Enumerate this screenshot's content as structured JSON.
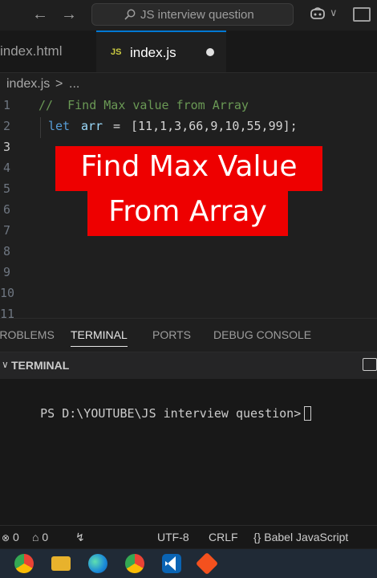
{
  "titlebar": {
    "search_text": "JS interview question",
    "back_arrow": "←",
    "forward_arrow": "→"
  },
  "tabs": [
    {
      "label": "index.html",
      "active": false
    },
    {
      "label": "index.js",
      "active": true,
      "icon": "JS",
      "modified": true
    }
  ],
  "breadcrumb": {
    "file": "index.js",
    "separator": ">",
    "rest": "..."
  },
  "editor": {
    "line_numbers": [
      "1",
      "2",
      "3",
      "4",
      "5",
      "6",
      "7",
      "8",
      "9",
      "10",
      "11"
    ],
    "current_line": "3",
    "code": {
      "line1_comment": "//  Find Max value from Array",
      "line2_keyword": "let",
      "line2_var": "arr",
      "line2_eq": "=",
      "line2_values": "[11,1,3,66,9,10,55,99];"
    }
  },
  "overlay": {
    "line1": "Find Max Value",
    "line2": "From Array",
    "color": "#ee0000"
  },
  "panel": {
    "tabs": [
      "PROBLEMS",
      "TERMINAL",
      "PORTS",
      "DEBUG CONSOLE"
    ],
    "active_tab": "TERMINAL",
    "terminal_title": "TERMINAL",
    "prompt": "PS D:\\YOUTUBE\\JS interview question>"
  },
  "statusbar": {
    "errors": "0",
    "ports": "0",
    "encoding": "UTF-8",
    "eol": "CRLF",
    "language": "Babel JavaScript",
    "language_icon": "{}"
  },
  "taskbar": {
    "icons": [
      "chrome-icon",
      "file-explorer-icon",
      "edge-icon",
      "chrome-icon",
      "vscode-icon",
      "git-icon"
    ]
  },
  "colors": {
    "accent": "#0078d4",
    "keyword": "#569cd6",
    "variable": "#9cdcfe",
    "comment": "#6a9955",
    "text": "#d4d4d4"
  }
}
